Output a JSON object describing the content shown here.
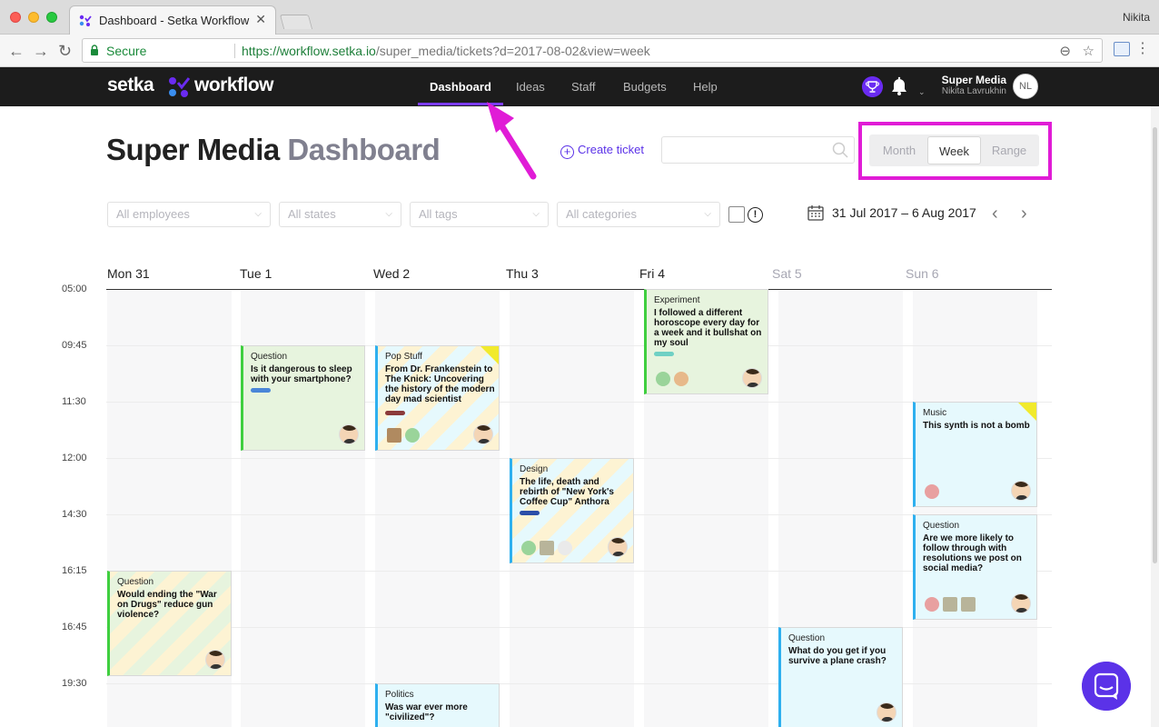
{
  "browser": {
    "tab_title": "Dashboard - Setka Workflow",
    "tab_close": "✕",
    "user": "Nikita",
    "secure_label": "Secure",
    "url_scheme_host": "https://workflow.setka.io",
    "url_rest": "/super_media/tickets?d=2017-08-02&view=week",
    "back": "←",
    "forward": "→",
    "reload": "↻",
    "zoom": "⊖",
    "star": "☆",
    "menu": "⋮"
  },
  "app": {
    "logo_setka": "setka",
    "logo_workflow": "workflow",
    "nav": [
      {
        "label": "Dashboard",
        "active": true
      },
      {
        "label": "Ideas"
      },
      {
        "label": "Staff"
      },
      {
        "label": "Budgets"
      },
      {
        "label": "Help"
      }
    ],
    "org_name": "Super Media",
    "user_name": "Nikita Lavrukhin",
    "user_initials": "NL",
    "chevron": "⌄"
  },
  "page": {
    "title_org": "Super Media",
    "title_sub": "Dashboard",
    "create_ticket": "Create ticket",
    "create_plus": "+",
    "search_value": "",
    "views": [
      {
        "label": "Month"
      },
      {
        "label": "Week",
        "active": true
      },
      {
        "label": "Range"
      }
    ]
  },
  "filters": {
    "employees": "All employees",
    "states": "All states",
    "tags": "All tags",
    "categories": "All categories",
    "chevron": "⌵",
    "info": "!",
    "date_range": "31 Jul 2017 – 6 Aug 2017",
    "prev": "‹",
    "next": "›"
  },
  "calendar": {
    "days": [
      {
        "label": "Mon 31"
      },
      {
        "label": "Tue 1"
      },
      {
        "label": "Wed 2"
      },
      {
        "label": "Thu 3"
      },
      {
        "label": "Fri 4"
      },
      {
        "label": "Sat 5",
        "weekend": true
      },
      {
        "label": "Sun 6",
        "weekend": true
      }
    ],
    "times": [
      "05:00",
      "09:45",
      "11:30",
      "12:00",
      "14:30",
      "16:15",
      "16:45",
      "19:30"
    ],
    "cards": [
      {
        "category": "Question",
        "title": "Is it dangerous to sleep with your smartphone?",
        "tag_color": "#4a86d8"
      },
      {
        "category": "Pop Stuff",
        "title": "From Dr. Frankenstein to The Knick: Uncovering the history of the modern day mad scientist",
        "tag_color": "#8b3a3a"
      },
      {
        "category": "Experiment",
        "title": "I followed a different horoscope every day for a week and it bullshat on my soul",
        "tag_color": "#6fd0c4"
      },
      {
        "category": "Music",
        "title": "This synth is not a bomb"
      },
      {
        "category": "Design",
        "title": "The life, death and rebirth of \"New York's Coffee Cup\" Anthora",
        "tag_color": "#2b4ea8"
      },
      {
        "category": "Question",
        "title": "Are we more likely to follow through with resolutions we post on social media?"
      },
      {
        "category": "Question",
        "title": "Would ending the \"War on Drugs\" reduce gun violence?"
      },
      {
        "category": "Question",
        "title": "What do you get if you survive a plane crash?"
      },
      {
        "category": "Politics",
        "title": "Was war ever more \"civilized\"?"
      }
    ]
  },
  "colors": {
    "accent": "#5b32e8",
    "annotation": "#e01cd6",
    "card_green_border": "#3fcf3f",
    "card_blue_border": "#2eb0ef"
  }
}
